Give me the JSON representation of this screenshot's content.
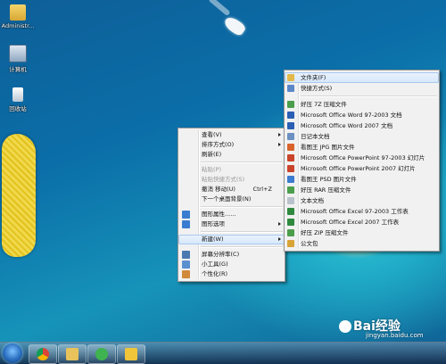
{
  "desktop": {
    "icons": [
      {
        "label": "Administr..."
      },
      {
        "label": "计算机"
      },
      {
        "label": "回收站"
      }
    ]
  },
  "context_menu": {
    "items": [
      {
        "label": "查看(V)",
        "submenu": true
      },
      {
        "label": "排序方式(O)",
        "submenu": true
      },
      {
        "label": "刷新(E)"
      },
      {
        "label": "粘贴(P)",
        "disabled": true
      },
      {
        "label": "粘贴快捷方式(S)",
        "disabled": true
      },
      {
        "label": "撤消 移动(U)",
        "shortcut": "Ctrl+Z"
      },
      {
        "label": "下一个桌面背景(N)"
      },
      {
        "label": "图形属性......"
      },
      {
        "label": "图形选项",
        "submenu": true
      },
      {
        "label": "新建(W)",
        "submenu": true
      },
      {
        "label": "屏幕分辨率(C)"
      },
      {
        "label": "小工具(G)"
      },
      {
        "label": "个性化(R)"
      }
    ]
  },
  "new_submenu": {
    "items": [
      {
        "label": "文件夹(F)",
        "icon": "folder-icon",
        "color": "#e2b84a"
      },
      {
        "label": "快捷方式(S)",
        "icon": "shortcut-icon",
        "color": "#5b86c8"
      },
      {
        "label": "好压 7Z 压缩文件",
        "icon": "archive-icon",
        "color": "#4b9e4b"
      },
      {
        "label": "Microsoft Office Word 97-2003 文档",
        "icon": "word-icon",
        "color": "#2b5fb4"
      },
      {
        "label": "Microsoft Office Word 2007 文档",
        "icon": "word-icon",
        "color": "#2b5fb4"
      },
      {
        "label": "日记本文档",
        "icon": "journal-icon",
        "color": "#6d8fc2"
      },
      {
        "label": "看图王 JPG 图片文件",
        "icon": "image-icon",
        "color": "#d9622b"
      },
      {
        "label": "Microsoft Office PowerPoint 97-2003 幻灯片",
        "icon": "powerpoint-icon",
        "color": "#c9442a"
      },
      {
        "label": "Microsoft Office PowerPoint 2007 幻灯片",
        "icon": "powerpoint-icon",
        "color": "#c9442a"
      },
      {
        "label": "看图王 PSD 图片文件",
        "icon": "image-icon",
        "color": "#3b7bd0"
      },
      {
        "label": "好压 RAR 压缩文件",
        "icon": "archive-icon",
        "color": "#4b9e4b"
      },
      {
        "label": "文本文档",
        "icon": "text-file-icon",
        "color": "#b9c2cc"
      },
      {
        "label": "Microsoft Office Excel 97-2003 工作表",
        "icon": "excel-icon",
        "color": "#2f8a3e"
      },
      {
        "label": "Microsoft Office Excel 2007 工作表",
        "icon": "excel-icon",
        "color": "#2f8a3e"
      },
      {
        "label": "好压 ZIP 压缩文件",
        "icon": "archive-icon",
        "color": "#4b9e4b"
      },
      {
        "label": "公文包",
        "icon": "briefcase-icon",
        "color": "#d9a436"
      }
    ]
  },
  "watermark": {
    "text": "Bai经验",
    "url": "jingyan.baidu.com"
  }
}
